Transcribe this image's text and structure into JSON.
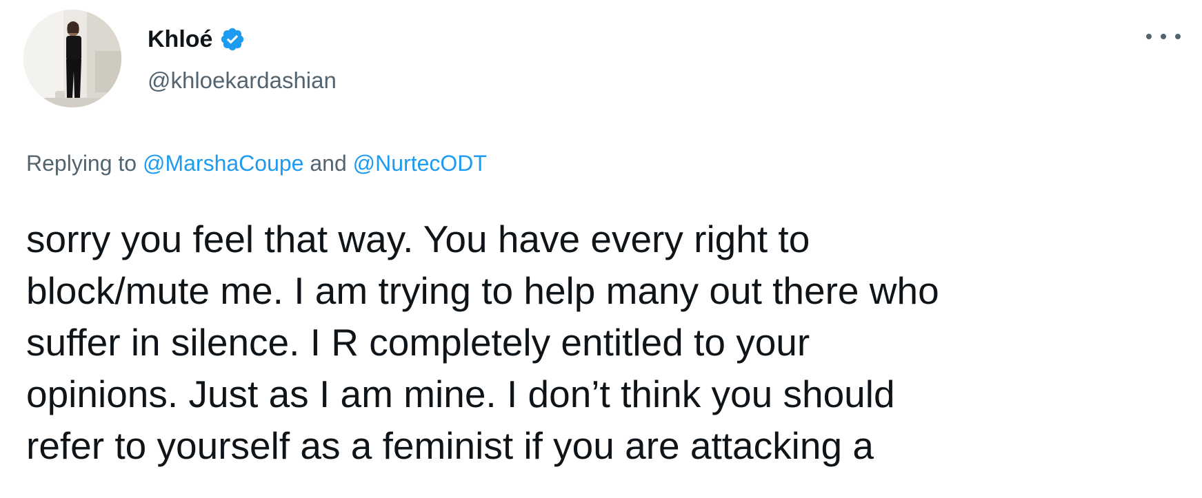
{
  "author": {
    "display_name": "Khloé",
    "handle": "@khloekardashian",
    "verified": true,
    "avatar": "profile-photo"
  },
  "colors": {
    "verified_badge": "#1d9bf0",
    "link": "#1d9bf0",
    "secondary_text": "#536471",
    "primary_text": "#0f1419"
  },
  "more_menu": {
    "icon": "more-horizontal-icon"
  },
  "reply_context": {
    "prefix": "Replying to",
    "mention_1": "@MarshaCoupe",
    "conjunction": "and",
    "mention_2": "@NurtecODT"
  },
  "tweet_text_lines": [
    "sorry you feel that way. You have every right to",
    "block/mute me. I am trying to help many out there who",
    "suffer in silence. I R completely entitled to your",
    "opinions. Just as I am mine. I don’t think you should",
    "refer to yourself as a feminist if you are attacking a"
  ]
}
